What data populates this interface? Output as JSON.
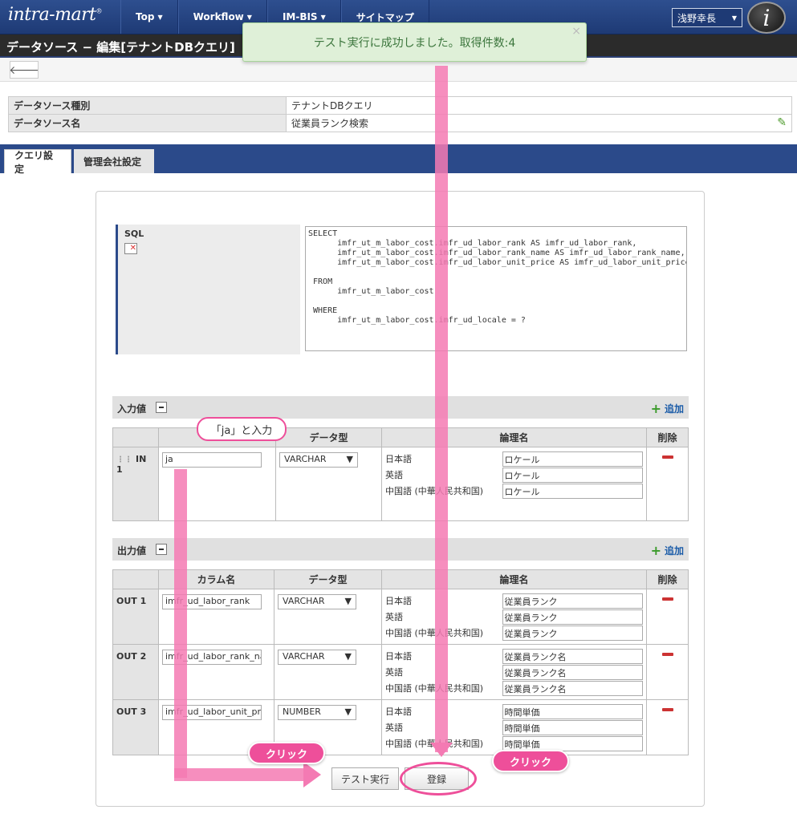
{
  "header": {
    "logo": "intra-mart",
    "nav": [
      {
        "label": "Top"
      },
      {
        "label": "Workflow"
      },
      {
        "label": "IM-BIS"
      },
      {
        "label": "サイトマップ"
      }
    ],
    "user_name": "浅野幸長"
  },
  "page": {
    "title": "データソース − 編集[テナントDBクエリ]"
  },
  "toast": {
    "message": "テスト実行に成功しました。取得件数:4"
  },
  "info": {
    "rows": [
      {
        "label": "データソース種別",
        "value": "テナントDBクエリ"
      },
      {
        "label": "データソース名",
        "value": "従業員ランク検索"
      }
    ]
  },
  "tabs": [
    {
      "label": "クエリ設定"
    },
    {
      "label": "管理会社設定"
    }
  ],
  "sql": {
    "label": "SQL",
    "text": "SELECT\n      imfr_ut_m_labor_cost.imfr_ud_labor_rank AS imfr_ud_labor_rank,\n      imfr_ut_m_labor_cost.imfr_ud_labor_rank_name AS imfr_ud_labor_rank_name,\n      imfr_ut_m_labor_cost.imfr_ud_labor_unit_price AS imfr_ud_labor_unit_price\n\n FROM\n      imfr_ut_m_labor_cost\n\n WHERE\n      imfr_ut_m_labor_cost.imfr_ud_locale = ?"
  },
  "input": {
    "title": "入力値",
    "add_label": "追加",
    "columns": [
      "",
      "データ型",
      "論理名",
      "削除"
    ],
    "rows": [
      {
        "id": "IN 1",
        "value": "ja",
        "type": "VARCHAR",
        "names": [
          {
            "lang": "日本語",
            "value": "ロケール"
          },
          {
            "lang": "英語",
            "value": "ロケール"
          },
          {
            "lang": "中国語 (中華人民共和国)",
            "value": "ロケール"
          }
        ]
      }
    ]
  },
  "output": {
    "title": "出力値",
    "add_label": "追加",
    "columns": [
      "",
      "カラム名",
      "データ型",
      "論理名",
      "削除"
    ],
    "rows": [
      {
        "id": "OUT 1",
        "value": "imfr_ud_labor_rank",
        "type": "VARCHAR",
        "names": [
          {
            "lang": "日本語",
            "value": "従業員ランク"
          },
          {
            "lang": "英語",
            "value": "従業員ランク"
          },
          {
            "lang": "中国語 (中華人民共和国)",
            "value": "従業員ランク"
          }
        ]
      },
      {
        "id": "OUT 2",
        "value": "imfr_ud_labor_rank_name",
        "type": "VARCHAR",
        "names": [
          {
            "lang": "日本語",
            "value": "従業員ランク名"
          },
          {
            "lang": "英語",
            "value": "従業員ランク名"
          },
          {
            "lang": "中国語 (中華人民共和国)",
            "value": "従業員ランク名"
          }
        ]
      },
      {
        "id": "OUT 3",
        "value": "imfr_ud_labor_unit_price",
        "type": "NUMBER",
        "names": [
          {
            "lang": "日本語",
            "value": "時間単価"
          },
          {
            "lang": "英語",
            "value": "時間単価"
          },
          {
            "lang": "中国語 (中華人民共和国)",
            "value": "時間単価"
          }
        ]
      }
    ]
  },
  "buttons": {
    "test_run": "テスト実行",
    "register": "登録"
  },
  "annotations": {
    "input_callout": "「ja」と入力",
    "click_left": "クリック",
    "click_right": "クリック"
  },
  "colors": {
    "header": "#1e3a75",
    "annotation_pink": "#ee4f9a",
    "toast_bg": "#dff0d8"
  }
}
